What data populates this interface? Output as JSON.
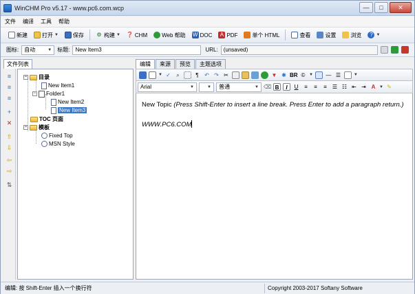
{
  "window": {
    "title": "WinCHM Pro v5.17 - www.pc6.com.wcp",
    "buttons": [
      "min",
      "max",
      "close"
    ]
  },
  "menu": [
    "文件",
    "编译",
    "工具",
    "帮助"
  ],
  "toolbar": {
    "new_label": "新建",
    "open_label": "打开",
    "save_label": "保存",
    "build_label": "构建",
    "chm_label": "CHM",
    "webhelp_label": "Web 帮助",
    "doc_label": "DOC",
    "pdf_label": "PDF",
    "single_html_label": "单个 HTML",
    "view_label": "查看",
    "settings_label": "设置",
    "browse_label": "浏览"
  },
  "propbar": {
    "icon_label": "图标:",
    "icon_value": "自动",
    "title_label": "标题:",
    "title_value": "New Item3",
    "url_label": "URL:",
    "url_value": "(unsaved)"
  },
  "left_panel": {
    "tab_label": "文件列表",
    "tree": {
      "toc": "目录",
      "new_item1": "New Item1",
      "folder1": "Folder1",
      "new_item2": "New Item2",
      "new_item3": "New Item3",
      "toc_page": "TOC 页面",
      "template": "模板",
      "fixed_top": "Fixed Top",
      "msn_style": "MSN Style"
    }
  },
  "right_panel": {
    "tabs": [
      "编辑",
      "来源",
      "预览",
      "主题选项"
    ],
    "font_name": "Arial",
    "style_value": "普通",
    "editor": {
      "line1_prefix": "New Topic ",
      "line1_italic": "(Press Shift-Enter to insert a line break. Press Enter to add a paragraph return.)",
      "line2": "WWW.PC6.COM"
    }
  },
  "statusbar": {
    "hint": "编辑: 按 Shift-Enter 插入一个换行符",
    "copyright": "Copyright 2003-2017 Softany Software"
  }
}
